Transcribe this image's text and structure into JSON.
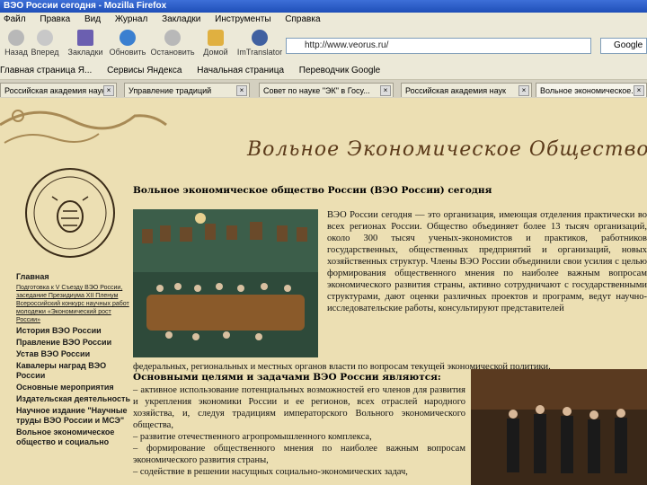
{
  "window": {
    "title": "ВЭО России сегодня - Mozilla Firefox"
  },
  "menu": [
    "Файл",
    "Правка",
    "Вид",
    "Журнал",
    "Закладки",
    "Инструменты",
    "Справка"
  ],
  "toolbar": {
    "back": "Назад",
    "forward": "Вперед",
    "bookmarks": "Закладки",
    "refresh": "Обновить",
    "stop": "Остановить",
    "home": "Домой",
    "translator": "ImTranslator"
  },
  "url": "http://www.veorus.ru/",
  "search": "Google",
  "bookmarks_bar": [
    "Главная страница Я...",
    "Сервисы Яндекса",
    "Начальная страница",
    "Переводчик Google"
  ],
  "tabs": [
    "Российская академия наук",
    "Управление традиций",
    "Совет по науке \"ЭК\" в Госу...",
    "Российская академия наук",
    "Вольное экономическое..."
  ],
  "page": {
    "headline": "Вольное Экономическое Общество России",
    "title": "Вольное экономическое общество России (ВЭО России) сегодня",
    "intro": "ВЭО России сегодня — это организация, имеющая отделения практически во всех регионах России. Общество объединяет более 13 тысяч организаций, около 300 тысяч ученых-экономистов и практиков, работников государственных, общественных предприятий и организаций, новых хозяйственных структур. Члены ВЭО России объединили свои усилия с целью формирования общественного мнения по наиболее важным вопросам экономического развития страны, активно сотрудничают с государственными структурами, дают оценки различных проектов и программ, ведут научно-исследовательские работы, консультируют представителей",
    "intro_cont": "федеральных, региональных и местных органов власти по вопросам текущей экономической политики.",
    "goals_title": "Основными целями и задачами ВЭО России являются:",
    "goals": [
      "– активное использование потенциальных возможностей его членов для развития и укрепления экономики России и ее регионов, всех отраслей народного хозяйства, и, следуя традициям императорского Вольного экономического общества,",
      "– развитие отечественного агропромышленного комплекса,",
      "– формирование общественного мнения по наиболее важным вопросам экономического развития страны,",
      "– содействие в решении насущных социально-экономических задач,"
    ]
  },
  "sidebar": {
    "items": [
      {
        "label": "Главная",
        "small": false
      },
      {
        "label": "Подготовка к V Съезду ВЭО России, заседание Президиума ХII Пленум Всероссийский конкурс научных работ молодежи «Экономический рост России»",
        "small": true
      },
      {
        "label": "История ВЭО России",
        "small": false
      },
      {
        "label": "Правление ВЭО России",
        "small": false
      },
      {
        "label": "Устав ВЭО России",
        "small": false
      },
      {
        "label": "Кавалеры наград ВЭО России",
        "small": false
      },
      {
        "label": "Основные мероприятия",
        "small": false
      },
      {
        "label": "Издательская деятельность",
        "small": false
      },
      {
        "label": "Научное издание \"Научные труды ВЭО России и МСЭ\"",
        "small": false
      },
      {
        "label": "Вольное экономическое общество и социально",
        "small": false
      }
    ]
  },
  "colors": {
    "page_bg": "#ecdfb3",
    "chrome": "#ece9d8",
    "title_bar": "#2a5bc8",
    "heading": "#5b3a1a"
  }
}
